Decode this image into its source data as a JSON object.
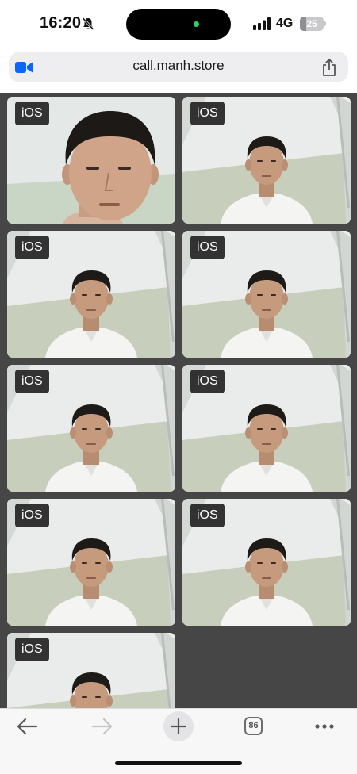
{
  "status_bar": {
    "time": "16:20",
    "network": "4G",
    "battery_level": "25",
    "battery_fraction": 0.25,
    "icons": [
      "bell-slash-icon",
      "signal-bars-icon",
      "battery-icon"
    ]
  },
  "browser": {
    "url": "call.manh.store",
    "icons": [
      "video-camera-icon",
      "share-icon"
    ]
  },
  "tiles": [
    {
      "label": "iOS",
      "view": "closeup"
    },
    {
      "label": "iOS",
      "view": "room"
    },
    {
      "label": "iOS",
      "view": "room"
    },
    {
      "label": "iOS",
      "view": "room"
    },
    {
      "label": "iOS",
      "view": "room"
    },
    {
      "label": "iOS",
      "view": "room"
    },
    {
      "label": "iOS",
      "view": "room"
    },
    {
      "label": "iOS",
      "view": "room"
    },
    {
      "label": "iOS",
      "view": "room"
    }
  ],
  "toolbar": {
    "tab_count": "86",
    "icons": [
      "back-arrow-icon",
      "forward-arrow-icon",
      "plus-icon",
      "tabs-icon",
      "more-icon"
    ]
  },
  "colors": {
    "content_background": "#464646",
    "label_background": "#1a1a1a",
    "toolbar_background": "#f7f7f7",
    "accent_blue": "#0a66ff"
  }
}
